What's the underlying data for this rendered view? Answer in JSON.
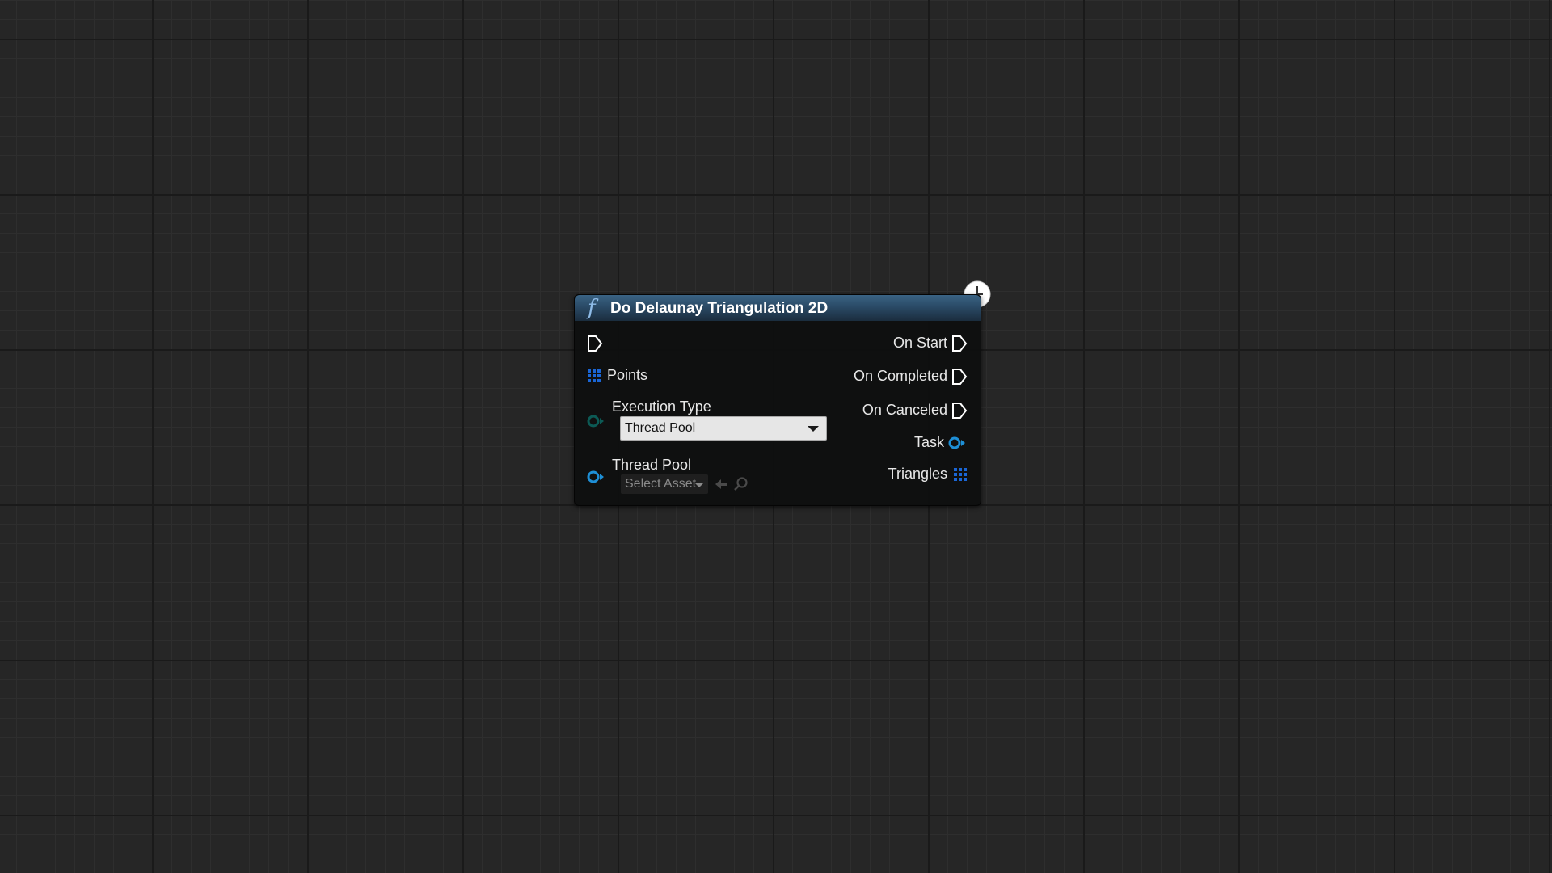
{
  "node": {
    "title": "Do Delaunay Triangulation 2D",
    "function_icon": "function-icon",
    "latent_icon": "clock-icon",
    "inputs": {
      "exec_in": {
        "icon": "exec-pin-icon"
      },
      "points": {
        "label": "Points",
        "icon": "array-pin-icon"
      },
      "execution_type": {
        "label": "Execution Type",
        "icon": "enum-pin-icon",
        "selected_value": "Thread Pool"
      },
      "thread_pool": {
        "label": "Thread Pool",
        "icon": "object-pin-icon",
        "asset_placeholder": "Select Asset",
        "use_selected_icon": "arrow-left-icon",
        "browse_icon": "search-icon"
      }
    },
    "outputs": {
      "on_start": {
        "label": "On Start",
        "icon": "exec-pin-icon"
      },
      "on_completed": {
        "label": "On Completed",
        "icon": "exec-pin-icon"
      },
      "on_canceled": {
        "label": "On Canceled",
        "icon": "exec-pin-icon"
      },
      "task": {
        "label": "Task",
        "icon": "object-pin-icon"
      },
      "triangles": {
        "label": "Triangles",
        "icon": "array-pin-icon"
      }
    }
  },
  "colors": {
    "background": "#262626",
    "header": "#2a4a66",
    "object_pin": "#1e8fd6",
    "enum_pin": "#0c5a55",
    "array_pin": "#1a66d6",
    "exec_pin": "#ffffff"
  }
}
